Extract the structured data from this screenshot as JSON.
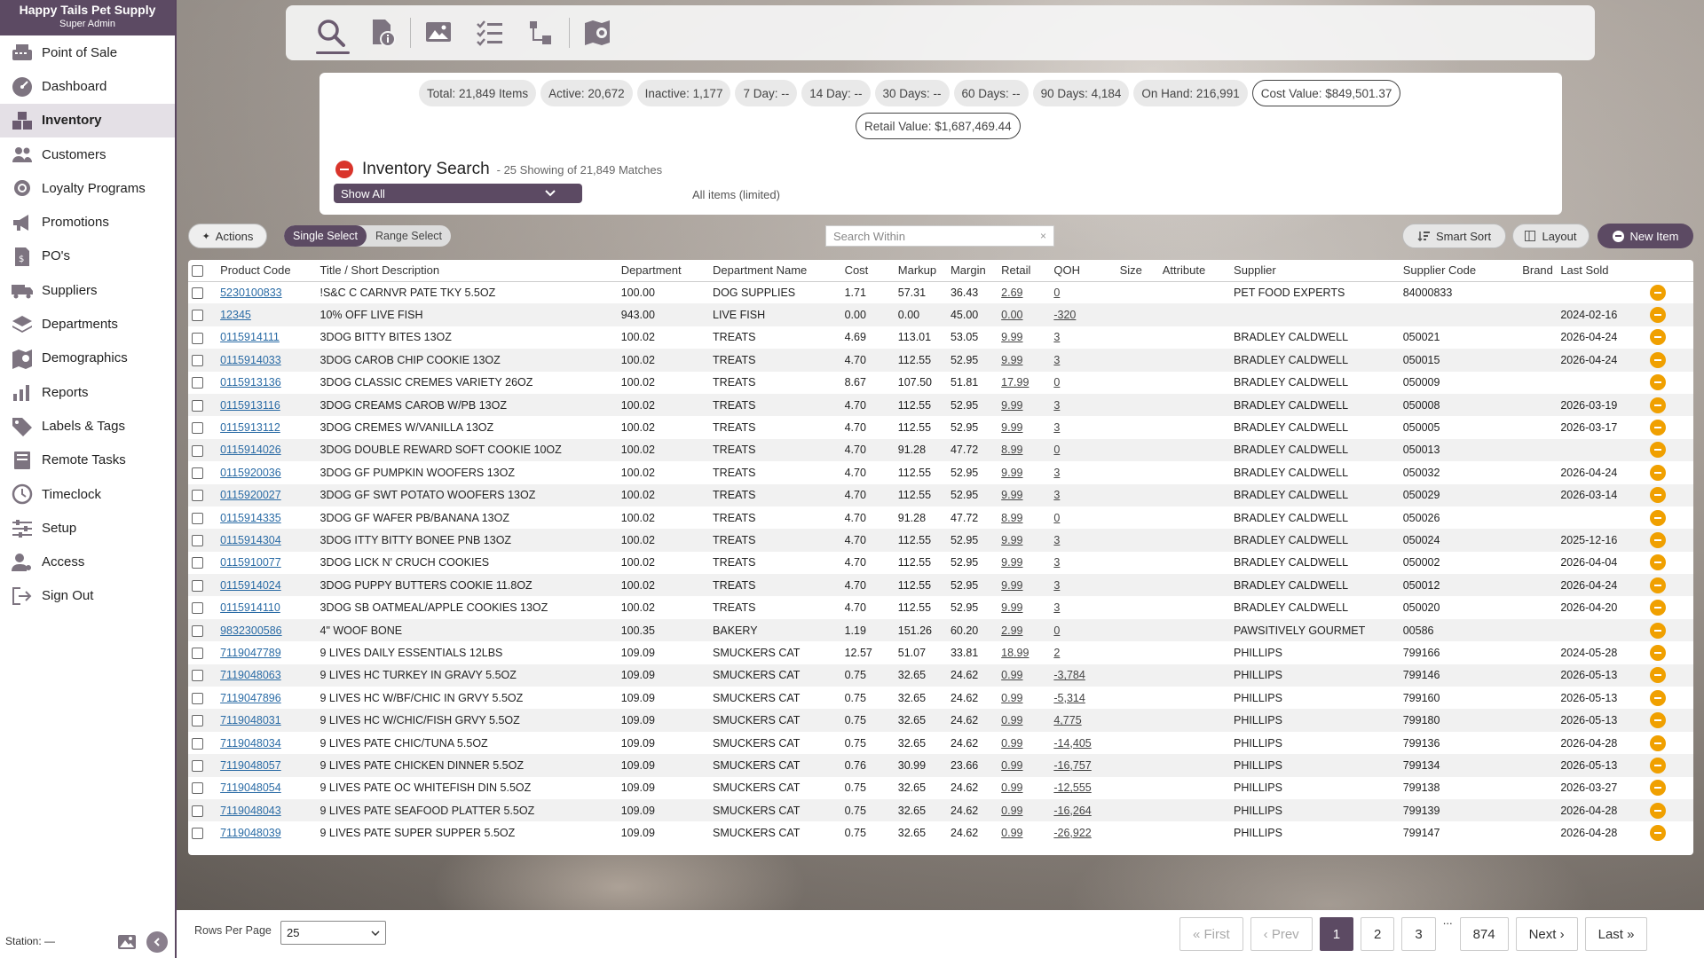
{
  "brand": {
    "name": "Happy Tails Pet Supply",
    "role": "Super Admin"
  },
  "nav": [
    {
      "label": "Point of Sale",
      "icon": "register-icon"
    },
    {
      "label": "Dashboard",
      "icon": "gauge-icon"
    },
    {
      "label": "Inventory",
      "icon": "boxes-icon",
      "active": true
    },
    {
      "label": "Customers",
      "icon": "people-icon"
    },
    {
      "label": "Loyalty Programs",
      "icon": "award-icon"
    },
    {
      "label": "Promotions",
      "icon": "megaphone-icon"
    },
    {
      "label": "PO's",
      "icon": "receipt-icon"
    },
    {
      "label": "Suppliers",
      "icon": "truck-icon"
    },
    {
      "label": "Departments",
      "icon": "layers-icon"
    },
    {
      "label": "Demographics",
      "icon": "map-icon"
    },
    {
      "label": "Reports",
      "icon": "chart-icon"
    },
    {
      "label": "Labels & Tags",
      "icon": "tag-icon"
    },
    {
      "label": "Remote Tasks",
      "icon": "server-icon"
    },
    {
      "label": "Timeclock",
      "icon": "clock-icon"
    },
    {
      "label": "Setup",
      "icon": "sliders-icon"
    },
    {
      "label": "Access",
      "icon": "user-key-icon"
    },
    {
      "label": "Sign Out",
      "icon": "sign-out-icon"
    }
  ],
  "station": "Station: —",
  "stats": [
    "Total: 21,849 Items",
    "Active: 20,672",
    "Inactive: 1,177",
    "7 Day: --",
    "14 Day: --",
    "30 Days: --",
    "60 Days: --",
    "90 Days: 4,184",
    "On Hand: 216,991",
    "Cost Value: $849,501.37"
  ],
  "retail_value": "Retail Value: $1,687,469.44",
  "search": {
    "title": "Inventory Search",
    "subtitle": "- 25 Showing of 21,849 Matches",
    "filter": "Show All",
    "scope": "All items (limited)",
    "within_placeholder": "Search Within",
    "clear": "×"
  },
  "actions": {
    "actions_label": "Actions",
    "single_select": "Single Select",
    "range_select": "Range Select",
    "smart_sort": "Smart Sort",
    "layout": "Layout",
    "new_item": "New Item"
  },
  "columns": [
    "Product Code",
    "Title / Short Description",
    "Department",
    "Department Name",
    "Cost",
    "Markup",
    "Margin",
    "Retail",
    "QOH",
    "Size",
    "Attribute",
    "Supplier",
    "Supplier Code",
    "Brand",
    "Last Sold"
  ],
  "rows": [
    [
      "5230100833",
      "!S&C C CARNVR PATE TKY 5.5OZ",
      "100.00",
      "DOG SUPPLIES",
      "1.71",
      "57.31",
      "36.43",
      "2.69",
      "0",
      "",
      "",
      "PET FOOD EXPERTS",
      "84000833",
      "",
      ""
    ],
    [
      "12345",
      "10% OFF LIVE FISH",
      "943.00",
      "LIVE FISH",
      "0.00",
      "0.00",
      "45.00",
      "0.00",
      "-320",
      "",
      "",
      "",
      "",
      "",
      "2024-02-16"
    ],
    [
      "0115914111",
      "3DOG BITTY BITES 13OZ",
      "100.02",
      "TREATS",
      "4.69",
      "113.01",
      "53.05",
      "9.99",
      "3",
      "",
      "",
      "BRADLEY CALDWELL",
      "050021",
      "",
      "2026-04-24"
    ],
    [
      "0115914033",
      "3DOG CAROB CHIP COOKIE 13OZ",
      "100.02",
      "TREATS",
      "4.70",
      "112.55",
      "52.95",
      "9.99",
      "3",
      "",
      "",
      "BRADLEY CALDWELL",
      "050015",
      "",
      "2026-04-24"
    ],
    [
      "0115913136",
      "3DOG CLASSIC CREMES VARIETY 26OZ",
      "100.02",
      "TREATS",
      "8.67",
      "107.50",
      "51.81",
      "17.99",
      "0",
      "",
      "",
      "BRADLEY CALDWELL",
      "050009",
      "",
      ""
    ],
    [
      "0115913116",
      "3DOG CREAMS CAROB W/PB 13OZ",
      "100.02",
      "TREATS",
      "4.70",
      "112.55",
      "52.95",
      "9.99",
      "3",
      "",
      "",
      "BRADLEY CALDWELL",
      "050008",
      "",
      "2026-03-19"
    ],
    [
      "0115913112",
      "3DOG CREMES W/VANILLA 13OZ",
      "100.02",
      "TREATS",
      "4.70",
      "112.55",
      "52.95",
      "9.99",
      "3",
      "",
      "",
      "BRADLEY CALDWELL",
      "050005",
      "",
      "2026-03-17"
    ],
    [
      "0115914026",
      "3DOG DOUBLE REWARD SOFT COOKIE 10OZ",
      "100.02",
      "TREATS",
      "4.70",
      "91.28",
      "47.72",
      "8.99",
      "0",
      "",
      "",
      "BRADLEY CALDWELL",
      "050013",
      "",
      ""
    ],
    [
      "0115920036",
      "3DOG GF PUMPKIN WOOFERS 13OZ",
      "100.02",
      "TREATS",
      "4.70",
      "112.55",
      "52.95",
      "9.99",
      "3",
      "",
      "",
      "BRADLEY CALDWELL",
      "050032",
      "",
      "2026-04-24"
    ],
    [
      "0115920027",
      "3DOG GF SWT POTATO WOOFERS 13OZ",
      "100.02",
      "TREATS",
      "4.70",
      "112.55",
      "52.95",
      "9.99",
      "3",
      "",
      "",
      "BRADLEY CALDWELL",
      "050029",
      "",
      "2026-03-14"
    ],
    [
      "0115914335",
      "3DOG GF WAFER PB/BANANA 13OZ",
      "100.02",
      "TREATS",
      "4.70",
      "91.28",
      "47.72",
      "8.99",
      "0",
      "",
      "",
      "BRADLEY CALDWELL",
      "050026",
      "",
      ""
    ],
    [
      "0115914304",
      "3DOG ITTY BITTY BONEE PNB 13OZ",
      "100.02",
      "TREATS",
      "4.70",
      "112.55",
      "52.95",
      "9.99",
      "3",
      "",
      "",
      "BRADLEY CALDWELL",
      "050024",
      "",
      "2025-12-16"
    ],
    [
      "0115910077",
      "3DOG LICK N' CRUCH COOKIES",
      "100.02",
      "TREATS",
      "4.70",
      "112.55",
      "52.95",
      "9.99",
      "3",
      "",
      "",
      "BRADLEY CALDWELL",
      "050002",
      "",
      "2026-04-04"
    ],
    [
      "0115914024",
      "3DOG PUPPY BUTTERS COOKIE 11.8OZ",
      "100.02",
      "TREATS",
      "4.70",
      "112.55",
      "52.95",
      "9.99",
      "3",
      "",
      "",
      "BRADLEY CALDWELL",
      "050012",
      "",
      "2026-04-24"
    ],
    [
      "0115914110",
      "3DOG SB OATMEAL/APPLE COOKIES 13OZ",
      "100.02",
      "TREATS",
      "4.70",
      "112.55",
      "52.95",
      "9.99",
      "3",
      "",
      "",
      "BRADLEY CALDWELL",
      "050020",
      "",
      "2026-04-20"
    ],
    [
      "9832300586",
      "4\" WOOF BONE",
      "100.35",
      "BAKERY",
      "1.19",
      "151.26",
      "60.20",
      "2.99",
      "0",
      "",
      "",
      "PAWSITIVELY GOURMET",
      "00586",
      "",
      ""
    ],
    [
      "7119047789",
      "9 LIVES DAILY ESSENTIALS 12LBS",
      "109.09",
      "SMUCKERS CAT",
      "12.57",
      "51.07",
      "33.81",
      "18.99",
      "2",
      "",
      "",
      "PHILLIPS",
      "799166",
      "",
      "2024-05-28"
    ],
    [
      "7119048063",
      "9 LIVES HC TURKEY IN GRAVY 5.5OZ",
      "109.09",
      "SMUCKERS CAT",
      "0.75",
      "32.65",
      "24.62",
      "0.99",
      "-3,784",
      "",
      "",
      "PHILLIPS",
      "799146",
      "",
      "2026-05-13"
    ],
    [
      "7119047896",
      "9 LIVES HC W/BF/CHIC IN GRVY 5.5OZ",
      "109.09",
      "SMUCKERS CAT",
      "0.75",
      "32.65",
      "24.62",
      "0.99",
      "-5,314",
      "",
      "",
      "PHILLIPS",
      "799160",
      "",
      "2026-05-13"
    ],
    [
      "7119048031",
      "9 LIVES HC W/CHIC/FISH GRVY 5.5OZ",
      "109.09",
      "SMUCKERS CAT",
      "0.75",
      "32.65",
      "24.62",
      "0.99",
      "4,775",
      "",
      "",
      "PHILLIPS",
      "799180",
      "",
      "2026-05-13"
    ],
    [
      "7119048034",
      "9 LIVES PATE CHIC/TUNA 5.5OZ",
      "109.09",
      "SMUCKERS CAT",
      "0.75",
      "32.65",
      "24.62",
      "0.99",
      "-14,405",
      "",
      "",
      "PHILLIPS",
      "799136",
      "",
      "2026-04-28"
    ],
    [
      "7119048057",
      "9 LIVES PATE CHICKEN DINNER 5.5OZ",
      "109.09",
      "SMUCKERS CAT",
      "0.76",
      "30.99",
      "23.66",
      "0.99",
      "-16,757",
      "",
      "",
      "PHILLIPS",
      "799134",
      "",
      "2026-05-13"
    ],
    [
      "7119048054",
      "9 LIVES PATE OC WHITEFISH DIN 5.5OZ",
      "109.09",
      "SMUCKERS CAT",
      "0.75",
      "32.65",
      "24.62",
      "0.99",
      "-12,555",
      "",
      "",
      "PHILLIPS",
      "799138",
      "",
      "2026-03-27"
    ],
    [
      "7119048043",
      "9 LIVES PATE SEAFOOD PLATTER 5.5OZ",
      "109.09",
      "SMUCKERS CAT",
      "0.75",
      "32.65",
      "24.62",
      "0.99",
      "-16,264",
      "",
      "",
      "PHILLIPS",
      "799139",
      "",
      "2026-04-28"
    ],
    [
      "7119048039",
      "9 LIVES PATE SUPER SUPPER 5.5OZ",
      "109.09",
      "SMUCKERS CAT",
      "0.75",
      "32.65",
      "24.62",
      "0.99",
      "-26,922",
      "",
      "",
      "PHILLIPS",
      "799147",
      "",
      "2026-04-28"
    ]
  ],
  "footer": {
    "rows_per_page_label": "Rows Per Page",
    "rows_per_page": "25",
    "first": "« First",
    "prev": "‹ Prev",
    "pages": [
      "1",
      "2",
      "3"
    ],
    "ellipsis": "...",
    "last_page": "874",
    "next": "Next ›",
    "last": "Last »"
  },
  "colors": {
    "brand": "#5c4a63",
    "danger": "#d9342b",
    "row_action": "#f0a000",
    "link": "#2a6ba5"
  }
}
